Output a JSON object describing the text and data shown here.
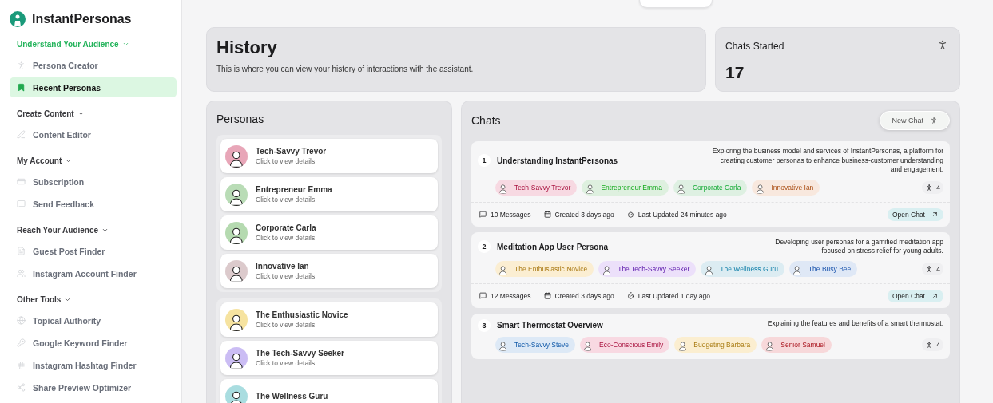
{
  "brand": {
    "name": "InstantPersonas"
  },
  "sidebar": {
    "sections": [
      {
        "title": "Understand Your Audience",
        "selected": true,
        "items": [
          {
            "label": "Persona Creator",
            "selected": false
          },
          {
            "label": "Recent Personas",
            "selected": true
          }
        ]
      },
      {
        "title": "Create Content",
        "selected": false,
        "items": [
          {
            "label": "Content Editor",
            "selected": false
          }
        ]
      },
      {
        "title": "My Account",
        "selected": false,
        "items": [
          {
            "label": "Subscription",
            "selected": false
          },
          {
            "label": "Send Feedback",
            "selected": false
          }
        ]
      },
      {
        "title": "Reach Your Audience",
        "selected": false,
        "items": [
          {
            "label": "Guest Post Finder",
            "selected": false
          },
          {
            "label": "Instagram Account Finder",
            "selected": false
          }
        ]
      },
      {
        "title": "Other Tools",
        "selected": false,
        "items": [
          {
            "label": "Topical Authority",
            "selected": false
          },
          {
            "label": "Google Keyword Finder",
            "selected": false
          },
          {
            "label": "Instagram Hashtag Finder",
            "selected": false
          },
          {
            "label": "Share Preview Optimizer",
            "selected": false
          }
        ]
      }
    ]
  },
  "header": {
    "title": "History",
    "subtitle": "This is where you can view your history of interactions with the assistant."
  },
  "stat": {
    "label": "Chats Started",
    "value": "17"
  },
  "personas": {
    "title": "Personas",
    "groups": [
      [
        {
          "name": "Tech-Savvy Trevor",
          "subtitle": "Click to view details",
          "color": "#e8a6b8"
        },
        {
          "name": "Entrepreneur Emma",
          "subtitle": "Click to view details",
          "color": "#b9dcb6"
        },
        {
          "name": "Corporate Carla",
          "subtitle": "Click to view details",
          "color": "#b5dab0"
        },
        {
          "name": "Innovative Ian",
          "subtitle": "Click to view details",
          "color": "#dccacc"
        }
      ],
      [
        {
          "name": "The Enthusiastic Novice",
          "subtitle": "Click to view details",
          "color": "#f6e3a0"
        },
        {
          "name": "The Tech-Savvy Seeker",
          "subtitle": "Click to view details",
          "color": "#cbbdf4"
        },
        {
          "name": "The Wellness Guru",
          "color": "#a9dde0"
        }
      ]
    ]
  },
  "chats": {
    "title": "Chats",
    "new_button": "New Chat",
    "items": [
      {
        "number": "1",
        "title": "Understanding InstantPersonas",
        "description": "Exploring the business model and services of InstantPersonas, a platform for creating customer personas to enhance business-customer understanding and engagement.",
        "personas": [
          {
            "name": "Tech-Savvy Trevor",
            "color": "#f7d9e2"
          },
          {
            "name": "Entrepreneur Emma",
            "color": "#def0df"
          },
          {
            "name": "Corporate Carla",
            "color": "#def0e2"
          },
          {
            "name": "Innovative Ian",
            "color": "#f8e8de"
          }
        ],
        "count": "4",
        "footer": {
          "messages": "10 Messages",
          "created": "Created 3 days ago",
          "updated": "Last Updated 24 minutes ago",
          "button": "Open Chat"
        }
      },
      {
        "number": "2",
        "title": "Meditation App User Persona",
        "description": "Developing user personas for a gamified meditation app focused on stress relief for young adults.",
        "personas": [
          {
            "name": "The Enthusiastic Novice",
            "color": "#fbeed2"
          },
          {
            "name": "The Tech-Savvy Seeker",
            "color": "#ece0fa"
          },
          {
            "name": "The Wellness Guru",
            "color": "#dcecf2"
          },
          {
            "name": "The Busy Bee",
            "color": "#dfe8f6"
          }
        ],
        "count": "4",
        "footer": {
          "messages": "12 Messages",
          "created": "Created 3 days ago",
          "updated": "Last Updated 1 day ago",
          "button": "Open Chat"
        }
      },
      {
        "number": "3",
        "title": "Smart Thermostat Overview",
        "description": "Explaining the features and benefits of a smart thermostat.",
        "personas": [
          {
            "name": "Tech-Savvy Steve",
            "color": "#dde9f6"
          },
          {
            "name": "Eco-Conscious Emily",
            "color": "#f8d9e2"
          },
          {
            "name": "Budgeting Barbara",
            "color": "#fbeed0"
          },
          {
            "name": "Senior Samuel",
            "color": "#f7d8da"
          }
        ],
        "count": "4"
      }
    ]
  }
}
